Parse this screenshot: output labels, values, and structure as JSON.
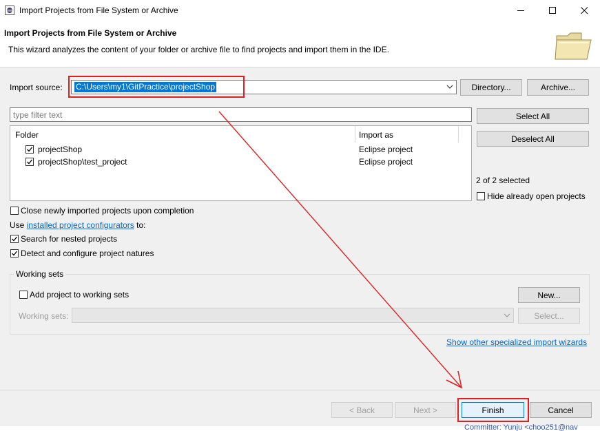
{
  "window": {
    "title": "Import Projects from File System or Archive",
    "app_icon": "eclipse-icon"
  },
  "header": {
    "title": "Import Projects from File System or Archive",
    "description": "This wizard analyzes the content of your folder or archive file to find projects and import them in the IDE.",
    "banner_icon": "folder-icon"
  },
  "import_source": {
    "label": "Import source:",
    "value": "C:\\Users\\my1\\GitPractice\\projectShop",
    "directory_button": "Directory...",
    "archive_button": "Archive..."
  },
  "filter": {
    "placeholder": "type filter text"
  },
  "table": {
    "columns": [
      "Folder",
      "Import as"
    ],
    "rows": [
      {
        "folder": "projectShop",
        "import_as": "Eclipse project",
        "checked": true
      },
      {
        "folder": "projectShop\\test_project",
        "import_as": "Eclipse project",
        "checked": true
      }
    ]
  },
  "selection": {
    "select_all": "Select All",
    "deselect_all": "Deselect All",
    "count_text": "2 of 2 selected",
    "hide_open_label": "Hide already open projects"
  },
  "options": {
    "close_imported": "Close newly imported projects upon completion",
    "use_prefix": "Use ",
    "configurators_link": "installed project configurators",
    "use_suffix": " to:",
    "search_nested": "Search for nested projects",
    "detect_natures": "Detect and configure project natures"
  },
  "working_sets": {
    "group_label": "Working sets",
    "add_label": "Add project to working sets",
    "new_button": "New...",
    "sets_label": "Working sets:",
    "select_button": "Select..."
  },
  "show_other_link": "Show other specialized import wizards",
  "footer": {
    "back": "< Back",
    "next": "Next >",
    "finish": "Finish",
    "cancel": "Cancel"
  },
  "background_text": "Committer: Yunju <choo251@nav",
  "colors": {
    "highlight": "#0078d7",
    "annotation_red": "#e02020",
    "link": "#0066cc"
  }
}
